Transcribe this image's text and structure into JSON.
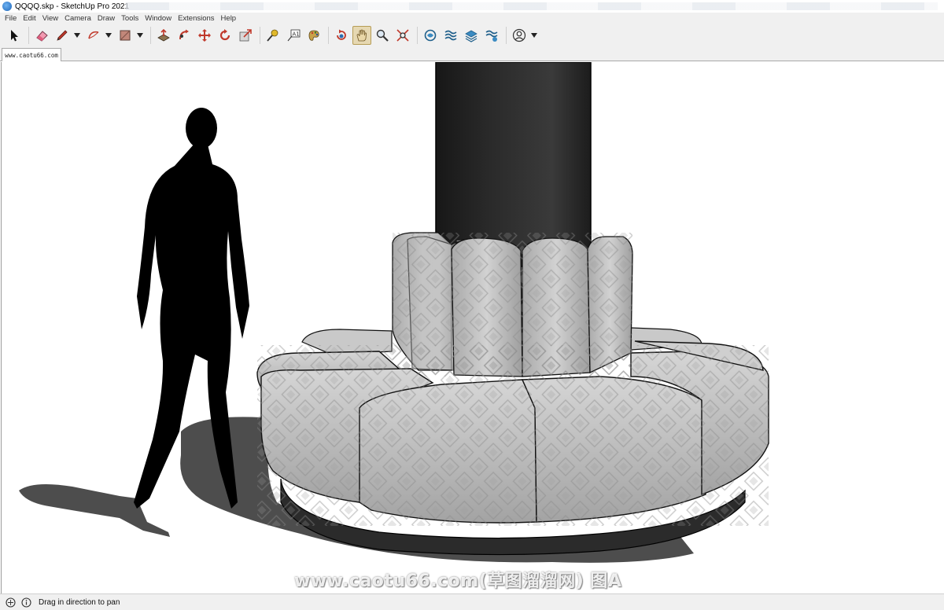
{
  "window": {
    "title": "QQQQ.skp - SketchUp Pro 2021"
  },
  "menu": [
    "File",
    "Edit",
    "View",
    "Camera",
    "Draw",
    "Tools",
    "Window",
    "Extensions",
    "Help"
  ],
  "toolbar": {
    "tools": [
      "select-icon",
      "eraser-icon",
      "pencil-icon",
      "arc-icon",
      "paint-bucket-icon",
      "push-pull-icon",
      "follow-me-icon",
      "move-icon",
      "rotate-icon",
      "scale-icon",
      "tape-measure-icon",
      "text-icon",
      "paint-icon",
      "orbit-icon",
      "pan-icon",
      "zoom-icon",
      "zoom-extents-icon",
      "warehouse-icon",
      "extension-warehouse-icon",
      "layers-icon",
      "styles-icon",
      "account-icon"
    ],
    "active_tool": "pan-icon"
  },
  "scene_tab": {
    "label": "www.caotu66.com"
  },
  "viewport": {
    "background": "#ffffff",
    "watermark": "www.caotu66.com(草图溜溜网) 图A"
  },
  "status": {
    "text": "Drag in direction to pan"
  },
  "colors": {
    "menubar": "#f0f0f0",
    "active_tool_bg": "#e6d8b2",
    "column": "#2b2b2b",
    "sofa": "#bdbdbd",
    "shadow": "#4d4d4d"
  }
}
